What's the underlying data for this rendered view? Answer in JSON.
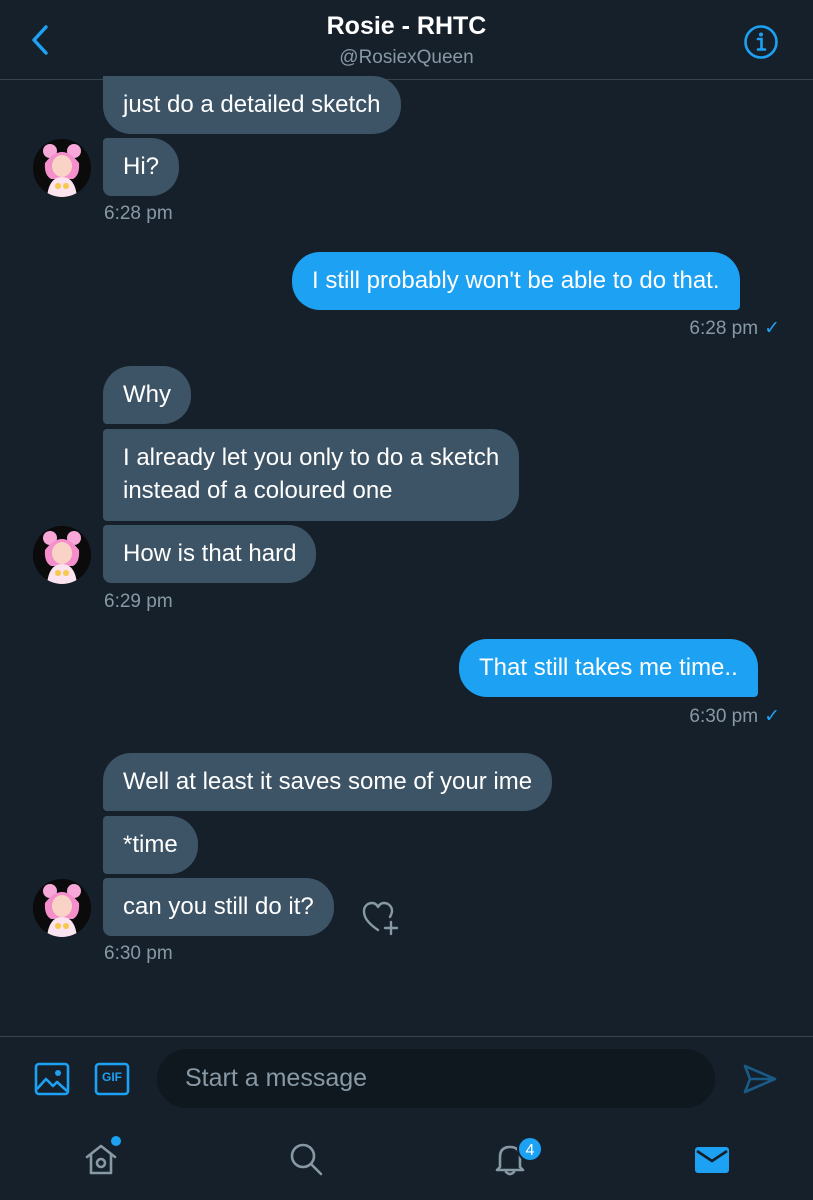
{
  "header": {
    "title": "Rosie - RHTC",
    "handle": "@RosiexQueen",
    "back_icon": "chevron-left-icon",
    "info_icon": "info-icon"
  },
  "messages": [
    {
      "direction": "in",
      "text": "just do a detailed sketch"
    },
    {
      "direction": "in",
      "text": "Hi?"
    },
    {
      "direction": "in",
      "time": "6:28 pm"
    },
    {
      "direction": "out",
      "text": "I still probably won't be able to do that.",
      "time": "6:28 pm",
      "check": "✓"
    },
    {
      "direction": "in",
      "text": "Why"
    },
    {
      "direction": "in",
      "line1": "I already let you only to do a sketch",
      "line2": "instead of a coloured one"
    },
    {
      "direction": "in",
      "text": "How is that hard",
      "time": "6:29 pm"
    },
    {
      "direction": "out",
      "text": "That still takes me time..",
      "time": "6:30 pm",
      "check": "✓"
    },
    {
      "direction": "in",
      "text": "Well at least it saves some of your ime"
    },
    {
      "direction": "in",
      "text": "*time"
    },
    {
      "direction": "in",
      "text": "can you still do it?",
      "time": "6:30 pm"
    }
  ],
  "compose": {
    "placeholder": "Start a message",
    "gif_label": "GIF"
  },
  "tabbar": {
    "notifications_count": "4",
    "items": [
      "home-icon",
      "search-icon",
      "notifications-icon",
      "messages-icon"
    ]
  },
  "colors": {
    "background": "#15202b",
    "incoming_bubble": "#3d5466",
    "outgoing_bubble": "#1da1f2",
    "accent": "#1da1f2",
    "secondary_text": "#8899a6"
  }
}
